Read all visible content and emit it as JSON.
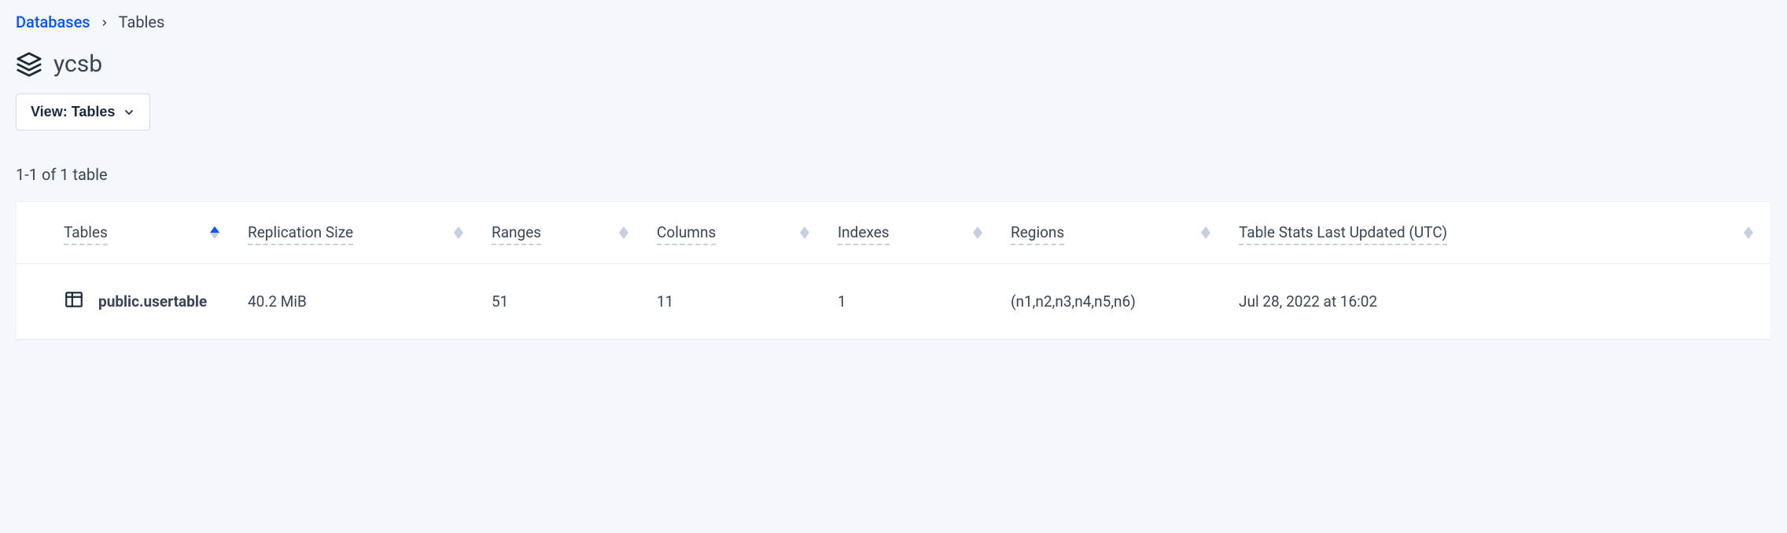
{
  "breadcrumb": {
    "root": "Databases",
    "current": "Tables"
  },
  "page": {
    "title": "ycsb",
    "view_label": "View: Tables",
    "count_text": "1-1 of 1 table"
  },
  "columns": {
    "tables": "Tables",
    "replication_size": "Replication Size",
    "ranges": "Ranges",
    "columns": "Columns",
    "indexes": "Indexes",
    "regions": "Regions",
    "updated": "Table Stats Last Updated (UTC)"
  },
  "rows": [
    {
      "name": "public.usertable",
      "replication_size": "40.2 MiB",
      "ranges": "51",
      "columns": "11",
      "indexes": "1",
      "regions": "(n1,n2,n3,n4,n5,n6)",
      "updated": "Jul 28, 2022 at 16:02"
    }
  ]
}
